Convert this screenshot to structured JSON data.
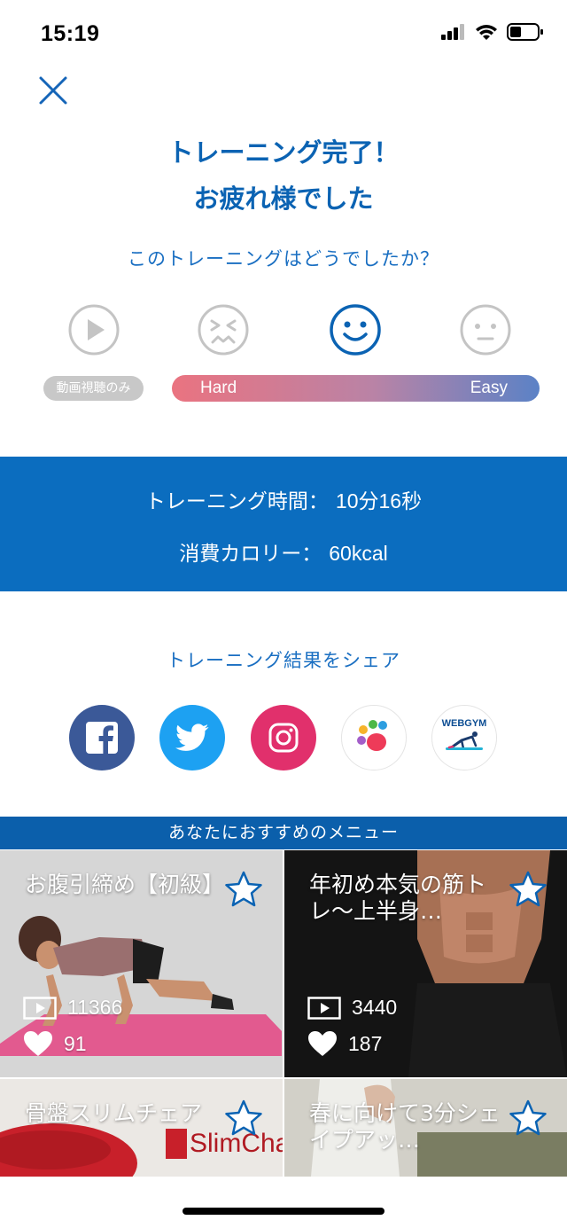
{
  "status_bar": {
    "time": "15:19"
  },
  "header": {
    "title_line1": "トレーニング完了！",
    "title_line2": "お疲れ様でした"
  },
  "feedback": {
    "question": "このトレーニングはどうでしたか？",
    "video_only_label": "動画視聴のみ",
    "hard_label": "Hard",
    "easy_label": "Easy",
    "options": [
      "play-icon",
      "struggle-face-icon",
      "smile-face-icon",
      "neutral-face-icon"
    ],
    "selected_option": "smile-face-icon"
  },
  "stats": {
    "time_label": "トレーニング時間：",
    "time_value": "10分16秒",
    "calorie_label": "消費カロリー：",
    "calorie_value": "60kcal"
  },
  "share": {
    "label": "トレーニング結果をシェア",
    "services": [
      "facebook",
      "twitter",
      "instagram",
      "paw-app",
      "webgym"
    ],
    "webgym_logo": "WEBGYM"
  },
  "recommendations": {
    "header": "あなたにおすすめのメニュー",
    "cards": [
      {
        "title": "お腹引締め【初級】",
        "views": "11366",
        "likes": "91"
      },
      {
        "title": "年初め本気の筋トレ〜上半身…",
        "views": "3440",
        "likes": "187"
      },
      {
        "title": "骨盤スリムチェア",
        "brand_text": "SlimCha"
      },
      {
        "title": "春に向けて3分シェイプアッ…"
      }
    ]
  },
  "colors": {
    "primary": "#0b6dbf",
    "header_band": "#0b5fab",
    "facebook": "#3b5998",
    "twitter": "#1da1f2",
    "instagram": "#e1306c",
    "hard_gradient_start": "#ea7380",
    "easy_gradient_end": "#5b82c6"
  }
}
